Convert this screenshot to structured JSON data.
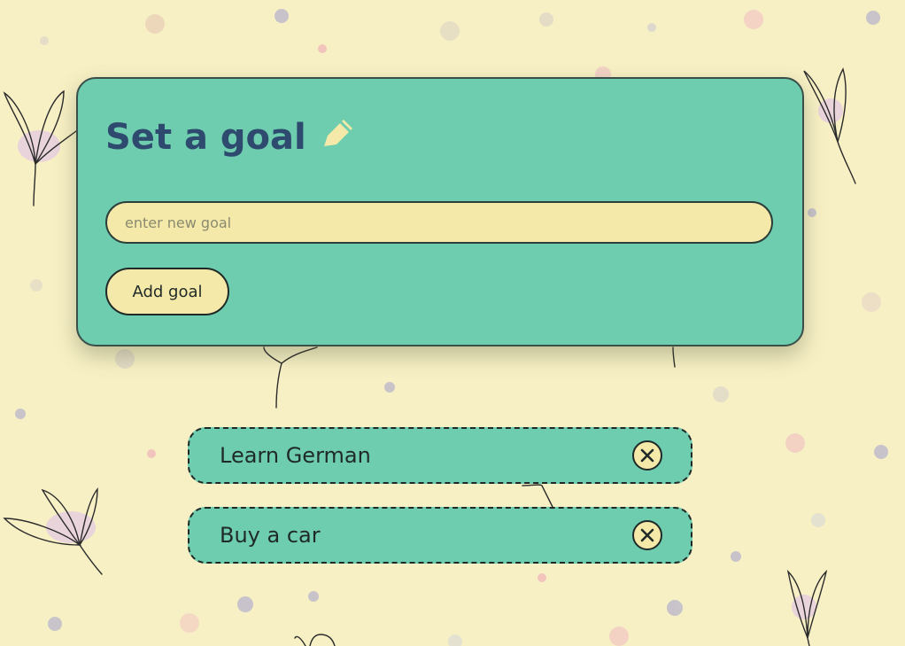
{
  "colors": {
    "background": "#f7f0c4",
    "card": "#6ecdae",
    "title": "#2e4a6e",
    "input_fill": "#f4e9a8",
    "pencil": "#f4e9a8"
  },
  "form": {
    "title": "Set a goal",
    "title_icon": "pencil-icon",
    "input_placeholder": "enter new goal",
    "input_value": "",
    "add_button_label": "Add goal"
  },
  "goals": [
    {
      "text": "Learn German",
      "remove_icon": "close-circle-icon"
    },
    {
      "text": "Buy a car",
      "remove_icon": "close-circle-icon"
    }
  ]
}
